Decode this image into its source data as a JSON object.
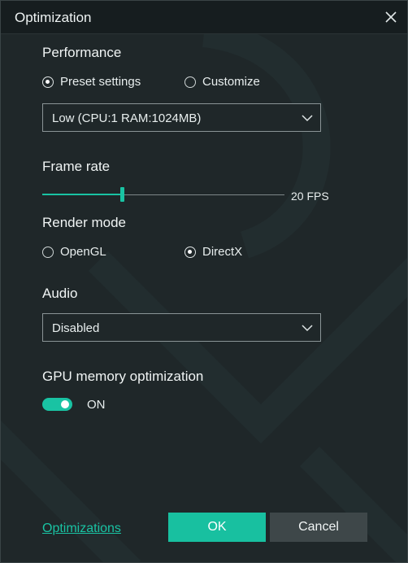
{
  "window": {
    "title": "Optimization"
  },
  "performance": {
    "label": "Performance",
    "options": [
      {
        "label": "Preset settings",
        "checked": true
      },
      {
        "label": "Customize",
        "checked": false
      }
    ],
    "preset_value": "Low (CPU:1 RAM:1024MB)"
  },
  "frame_rate": {
    "label": "Frame rate",
    "value_label": "20 FPS",
    "level_fraction": 0.33
  },
  "render_mode": {
    "label": "Render mode",
    "options": [
      {
        "label": "OpenGL",
        "checked": false
      },
      {
        "label": "DirectX",
        "checked": true
      }
    ]
  },
  "audio": {
    "label": "Audio",
    "value": "Disabled"
  },
  "gpu_memory": {
    "label": "GPU memory optimization",
    "state": "ON",
    "enabled": true
  },
  "footer": {
    "link_label": "Optimizations",
    "ok_label": "OK",
    "cancel_label": "Cancel"
  },
  "colors": {
    "accent": "#19c3a3",
    "background": "#1f2729",
    "titlebar": "#161d1f",
    "cancel_button": "#3e4749"
  },
  "icons": {
    "close": "close-icon",
    "dropdown": "chevron-down-icon"
  }
}
